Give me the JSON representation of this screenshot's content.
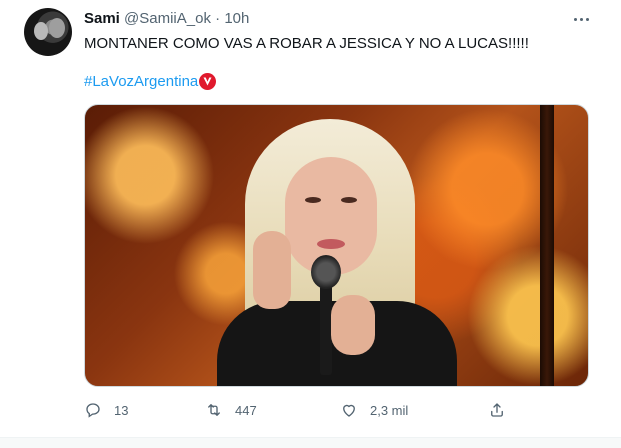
{
  "tweet": {
    "author_name": "Sami",
    "handle": "@SamiiA_ok",
    "separator": "·",
    "time": "10h",
    "text": "MONTANER COMO VAS A ROBAR A JESSICA Y NO A LUCAS!!!!!",
    "hashtag": "#LaVozArgentina"
  },
  "actions": {
    "reply_count": "13",
    "retweet_count": "447",
    "like_count": "2,3 mil"
  },
  "icons": {
    "more": "more-horizontal-icon",
    "reply": "reply-icon",
    "retweet": "retweet-icon",
    "like": "heart-icon",
    "share": "share-icon",
    "hashflag": "la-voz-hashflag-icon"
  },
  "colors": {
    "text": "#0f1419",
    "secondary": "#536471",
    "link": "#1d9bf0",
    "hashflag": "#e0192d"
  }
}
